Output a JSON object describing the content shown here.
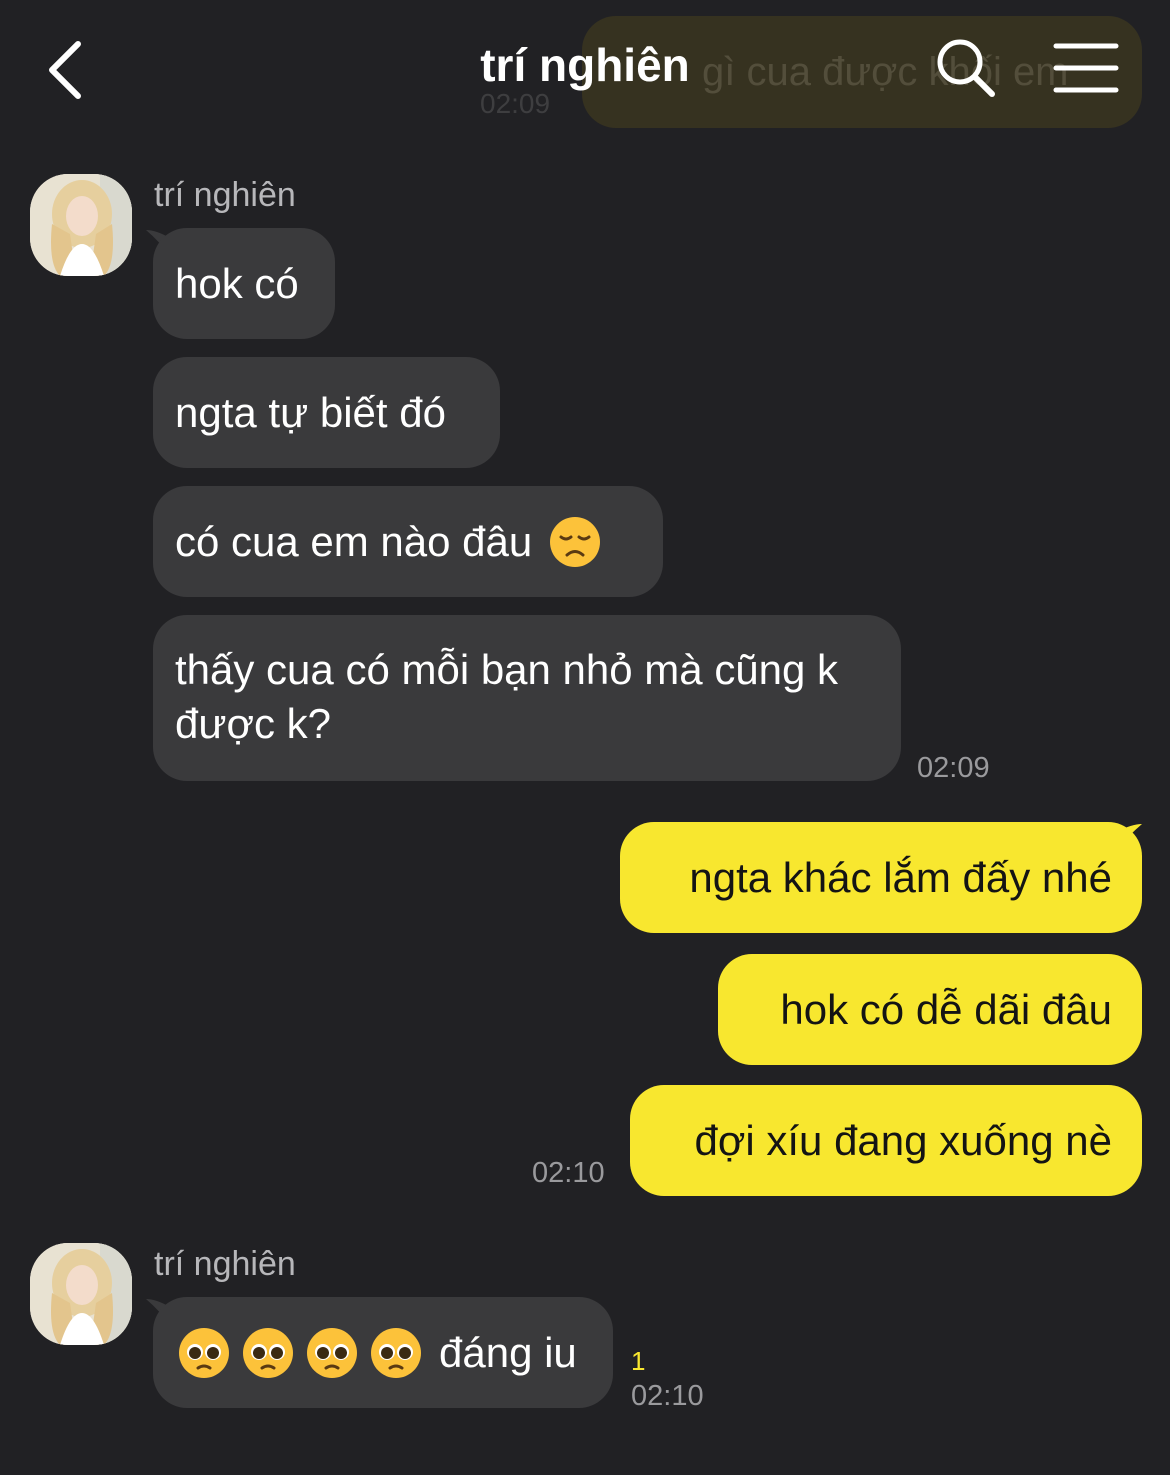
{
  "ghost_message": {
    "text": "gì cua được khối em",
    "time": "02:09"
  },
  "header": {
    "title": "trí nghiên",
    "back_icon": "chevron-left-icon",
    "search_icon": "search-icon",
    "menu_icon": "hamburger-menu-icon"
  },
  "colors": {
    "background": "#212124",
    "incoming_bubble": "#3a3a3c",
    "outgoing_bubble": "#f8e72f",
    "unread": "#f8e72f"
  },
  "groups": [
    {
      "sender": "trí nghiên",
      "messages": [
        "hok có",
        "ngta tự biết đó",
        "có cua em nào đâu",
        "thấy cua có mỗi bạn nhỏ mà cũng k được k?"
      ],
      "time": "02:09"
    },
    {
      "messages": [
        "ngta khác lắm đấy nhé",
        "hok có dễ dãi đâu",
        "đợi xíu đang xuống nè"
      ],
      "time": "02:10"
    },
    {
      "sender": "trí nghiên",
      "messages": [
        "đáng iu"
      ],
      "unread_count": "1",
      "time": "02:10"
    }
  ]
}
